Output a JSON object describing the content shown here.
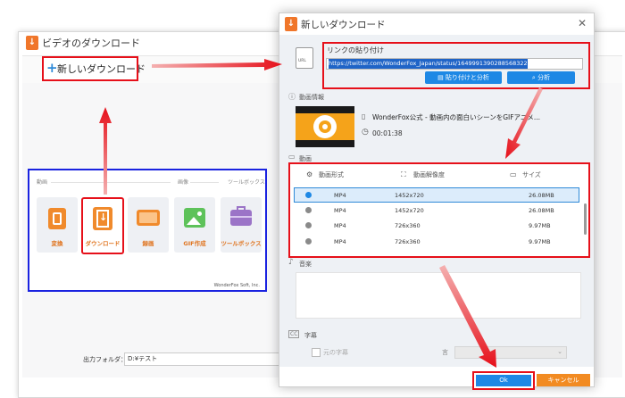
{
  "background_window": {
    "title": "ビデオのダウンロード",
    "toolbar_button": "新しいダウンロード",
    "sections": [
      "動画",
      "画像",
      "ツールボックス"
    ],
    "tools": [
      {
        "label": "変換",
        "icon": "film-icon"
      },
      {
        "label": "ダウンロード",
        "icon": "download-icon"
      },
      {
        "label": "録画",
        "icon": "monitor-icon"
      },
      {
        "label": "GIF作成",
        "icon": "image-icon"
      },
      {
        "label": "ツールボックス",
        "icon": "toolbox-icon"
      }
    ],
    "brand": "WonderFox Soft, Inc.",
    "output_folder_label": "出力フォルダ：",
    "output_folder_value": "D:¥テスト"
  },
  "dialog": {
    "title": "新しいダウンロード",
    "close": "✕",
    "paste": {
      "title": "リンクの貼り付け",
      "url": "https://twitter.com/WonderFox_Japan/status/1649991390288568322",
      "paste_analyze_button": "貼り付けと分析",
      "analyze_button": "分析"
    },
    "video_info": {
      "header": "動画情報",
      "title": "WonderFox公式 - 動画内の面白いシーンをGIFアニメ...",
      "duration": "00:01:38"
    },
    "video": {
      "header": "動画",
      "columns": [
        "動画形式",
        "動画解像度",
        "サイズ"
      ],
      "rows": [
        {
          "format": "MP4",
          "resolution": "1452x720",
          "size": "26.08MB",
          "selected": true
        },
        {
          "format": "MP4",
          "resolution": "1452x720",
          "size": "26.08MB",
          "selected": false
        },
        {
          "format": "MP4",
          "resolution": "726x360",
          "size": "9.97MB",
          "selected": false
        },
        {
          "format": "MP4",
          "resolution": "726x360",
          "size": "9.97MB",
          "selected": false
        }
      ]
    },
    "audio": {
      "header": "音楽"
    },
    "subtitle": {
      "header": "字幕",
      "original_label": "元の字幕",
      "language_label": "言"
    },
    "ok_button": "Ok",
    "cancel_button": "キャンセル"
  },
  "colors": {
    "highlight_red": "#e6101a",
    "accent_blue": "#1e88e5",
    "accent_orange": "#f28b22",
    "panel_blue": "#1a23e0"
  }
}
